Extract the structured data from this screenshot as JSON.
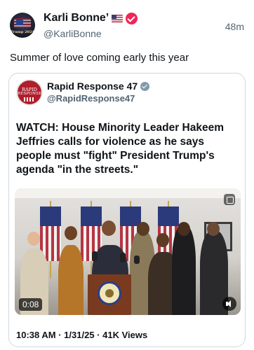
{
  "post": {
    "display_name": "Karli Bonne’",
    "handle": "@KarliBonne",
    "timestamp": "48m",
    "text": "Summer of love coming early this year",
    "avatar_text": "Trump 2024"
  },
  "quote": {
    "display_name": "Rapid Response 47",
    "handle": "@RapidResponse47",
    "avatar_line1": "RAPID",
    "avatar_line2": "RESPONSE",
    "headline": "WATCH: House Minority Leader Hakeem Jeffries calls for violence as he says people must \"fight\" President Trump's agenda \"in the streets.\"",
    "video": {
      "duration": "0:08"
    },
    "time": "10:38 AM",
    "date": "1/31/25",
    "views": "41K Views",
    "separator": " · "
  },
  "colors": {
    "accent_verified": "#f0265a",
    "gray_verified": "#829aab",
    "text_secondary": "#536471"
  }
}
